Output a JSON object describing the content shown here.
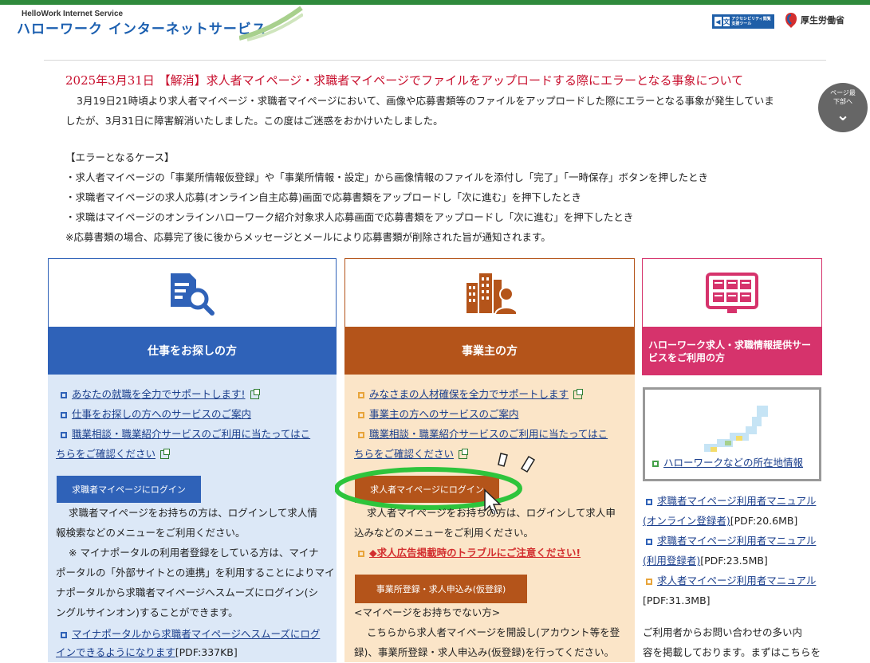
{
  "header": {
    "logo_en": "HelloWork Internet Service",
    "logo_jp": "ハローワーク インターネットサービス",
    "accessibility_badge": "アクセシビリティ閲覧支援ツール",
    "ministry": "厚生労働省",
    "page_down_label": "ページ最下部へ"
  },
  "notice": {
    "title": "2025年3月31日 【解消】求人者マイページ・求職者マイページでファイルをアップロードする際にエラーとなる事象について",
    "lines": [
      "3月19日21時頃より求人者マイページ・求職者マイページにおいて、画像や応募書類等のファイルをアップロードした際にエラーとなる事象が発生していま",
      "したが、3月31日に障害解消いたしました。この度はご迷惑をおかけいたしました。",
      "【エラーとなるケース】",
      "・求人者マイページの「事業所情報仮登録」や「事業所情報・設定」から画像情報のファイルを添付し「完了」「一時保存」ボタンを押したとき",
      "・求職者マイページの求人応募(オンライン自主応募)画面で応募書類をアップロードし「次に進む」を押下したとき",
      "・求職はマイページのオンラインハローワーク紹介対象求人応募画面で応募書類をアップロードし「次に進む」を押下したとき",
      "※応募書類の場合、応募完了後に後からメッセージとメールにより応募書類が削除された旨が通知されます。"
    ]
  },
  "job_seeker": {
    "title": "仕事をお探しの方",
    "links": [
      "あなたの就職を全力でサポートします!",
      "仕事をお探しの方へのサービスのご案内",
      "職業相談・職業紹介サービスのご利用に当たってはこ",
      "ちらをご確認ください"
    ],
    "login_button": "求職者マイページにログイン",
    "desc": [
      "求職者マイページをお持ちの方は、ログインして求人情",
      "報検索などのメニューをご利用ください。",
      "※ マイナポータルの利用者登録をしている方は、マイナ",
      "ポータルの「外部サイトとの連携」を利用することによりマイ",
      "ナポータルから求職者マイページへスムーズにログイン(シ",
      "ングルサインオン)することができます。"
    ],
    "mynaportal_link": [
      "マイナポータルから求職者マイページへスムーズにログ",
      "インできるようになります"
    ],
    "mynaportal_size": "[PDF:337KB]"
  },
  "employer": {
    "title": "事業主の方",
    "links": [
      "みなさまの人材確保を全力でサポートします",
      "事業主の方へのサービスのご案内",
      "職業相談・職業紹介サービスのご利用に当たってはこ",
      "ちらをご確認ください"
    ],
    "login_button": "求人者マイページにログイン",
    "desc": [
      "求人者マイページをお持ちの方は、ログインして求人申",
      "込みなどのメニューをご利用ください。"
    ],
    "warning_link": "◆求人広告掲載時のトラブルにご注意ください!",
    "register_button": "事業所登録・求人申込み(仮登録)",
    "no_page_label": "<マイページをお持ちでない方>",
    "register_desc": [
      "こちらから求人者マイページを開設し(アカウント等を登",
      "録)、事業所登録・求人申込み(仮登録)を行ってください。"
    ]
  },
  "info_service": {
    "title": "ハローワーク求人・求職情報提供サービスをご利用の方",
    "map_link": "ハローワークなどの所在地情報",
    "manuals": [
      {
        "line1": "求職者マイページ利用者マニュアル",
        "line2": "(オンライン登録者)",
        "size": "[PDF:20.6MB]"
      },
      {
        "line1": "求職者マイページ利用者マニュアル",
        "line2": "(利用登録者)",
        "size": "[PDF:23.5MB]"
      },
      {
        "line1": "求人者マイページ利用者マニュアル",
        "line2": "",
        "size": "[PDF:31.3MB]"
      }
    ],
    "faq_text": [
      "ご利用者からお問い合わせの多い内",
      "容を掲載しております。まずはこちらを"
    ]
  },
  "colors": {
    "job_seeker": "#2f62b8",
    "employer": "#b4541a",
    "info": "#d6336c",
    "highlight_ring": "#2ec43c"
  }
}
